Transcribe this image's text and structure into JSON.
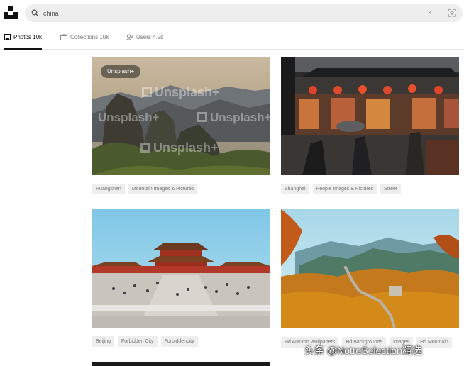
{
  "search": {
    "value": "china",
    "clear_label": "×",
    "placeholder": ""
  },
  "tabs": [
    {
      "label": "Photos 10k",
      "icon": "photo-icon",
      "active": true
    },
    {
      "label": "Collections 10k",
      "icon": "collection-icon",
      "active": false
    },
    {
      "label": "Users 4.2k",
      "icon": "users-icon",
      "active": false
    }
  ],
  "photos": [
    {
      "badge": "Unsplash+",
      "watermark": "Unsplash+",
      "tags": [
        "Huangshan",
        "Mountain Images & Pictures"
      ]
    },
    {
      "tags": [
        "Shanghai",
        "People Images & Pictures",
        "Street"
      ]
    },
    {
      "tags": [
        "Beijing",
        "Forbidden City",
        "Forbiddencity"
      ]
    },
    {
      "tags": [
        "Hd Autumn Wallpapers",
        "Hd Backgrounds",
        "Images",
        "Hd Mountain"
      ]
    }
  ],
  "credit": "头条 @NotreSelection精选",
  "colors": {
    "tab_active": "#111111",
    "tag_bg": "#eeeeee",
    "search_bg": "#eeeeee"
  }
}
